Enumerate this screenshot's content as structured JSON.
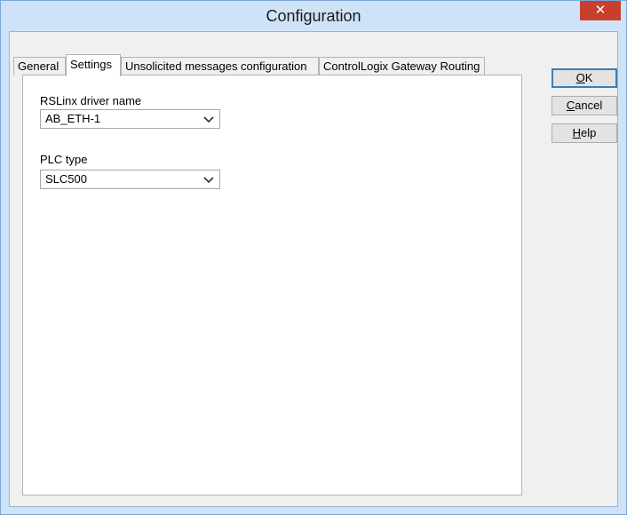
{
  "window": {
    "title": "Configuration",
    "close_glyph": "✕"
  },
  "tabs": [
    {
      "label": "General",
      "active": false
    },
    {
      "label": "Settings",
      "active": true
    },
    {
      "label": "Unsolicited messages configuration",
      "active": false
    },
    {
      "label": "ControlLogix Gateway Routing",
      "active": false
    }
  ],
  "settings": {
    "driver_label": "RSLinx driver name",
    "driver_value": "AB_ETH-1",
    "plc_label": "PLC type",
    "plc_value": "SLC500"
  },
  "buttons": {
    "ok": {
      "accel": "O",
      "rest": "K"
    },
    "cancel": {
      "accel": "C",
      "rest": "ancel"
    },
    "help": {
      "accel": "H",
      "rest": "elp"
    }
  },
  "icons": {
    "close": "close-icon",
    "dropdown": "chevron-down-icon"
  },
  "colors": {
    "frame": "#cfe3f8",
    "close_button": "#c7402e",
    "panel": "#ffffff",
    "client": "#f0f0f0"
  }
}
